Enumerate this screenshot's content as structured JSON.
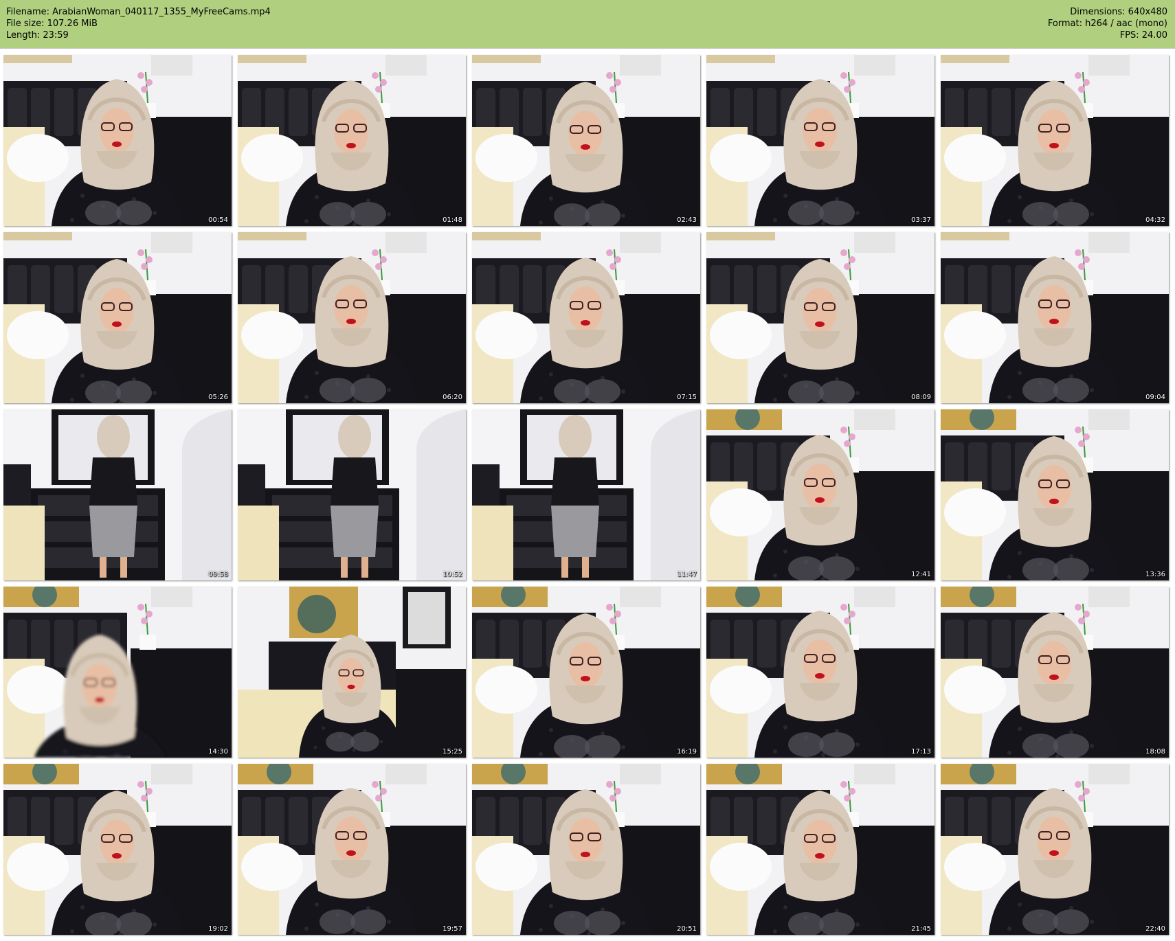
{
  "file_info": {
    "filename": "Filename: ArabianWoman_040117_1355_MyFreeCams.mp4",
    "file_size": "File size: 107.26 MiB",
    "length": "Length: 23:59",
    "dimensions": "Dimensions: 640x480",
    "format": "Format: h264 / aac (mono)",
    "fps": "FPS: 24.00"
  },
  "colors": {
    "header_bg": "#b0cf7f",
    "page_bg": "#ffffff"
  },
  "thumbnails": [
    {
      "time": "00:54",
      "scene": "bed"
    },
    {
      "time": "01:48",
      "scene": "bed"
    },
    {
      "time": "02:43",
      "scene": "bed"
    },
    {
      "time": "03:37",
      "scene": "bed"
    },
    {
      "time": "04:32",
      "scene": "bed"
    },
    {
      "time": "05:26",
      "scene": "bed"
    },
    {
      "time": "06:20",
      "scene": "bed"
    },
    {
      "time": "07:15",
      "scene": "bed"
    },
    {
      "time": "08:09",
      "scene": "bed"
    },
    {
      "time": "09:04",
      "scene": "bed"
    },
    {
      "time": "09:58",
      "scene": "mirror"
    },
    {
      "time": "10:52",
      "scene": "mirror"
    },
    {
      "time": "11:47",
      "scene": "mirror"
    },
    {
      "time": "12:41",
      "scene": "art"
    },
    {
      "time": "13:36",
      "scene": "art"
    },
    {
      "time": "14:30",
      "scene": "art"
    },
    {
      "time": "15:25",
      "scene": "wide"
    },
    {
      "time": "16:19",
      "scene": "art"
    },
    {
      "time": "17:13",
      "scene": "art"
    },
    {
      "time": "18:08",
      "scene": "art"
    },
    {
      "time": "19:02",
      "scene": "art"
    },
    {
      "time": "19:57",
      "scene": "art"
    },
    {
      "time": "20:51",
      "scene": "art"
    },
    {
      "time": "21:45",
      "scene": "art"
    },
    {
      "time": "22:40",
      "scene": "art"
    }
  ]
}
